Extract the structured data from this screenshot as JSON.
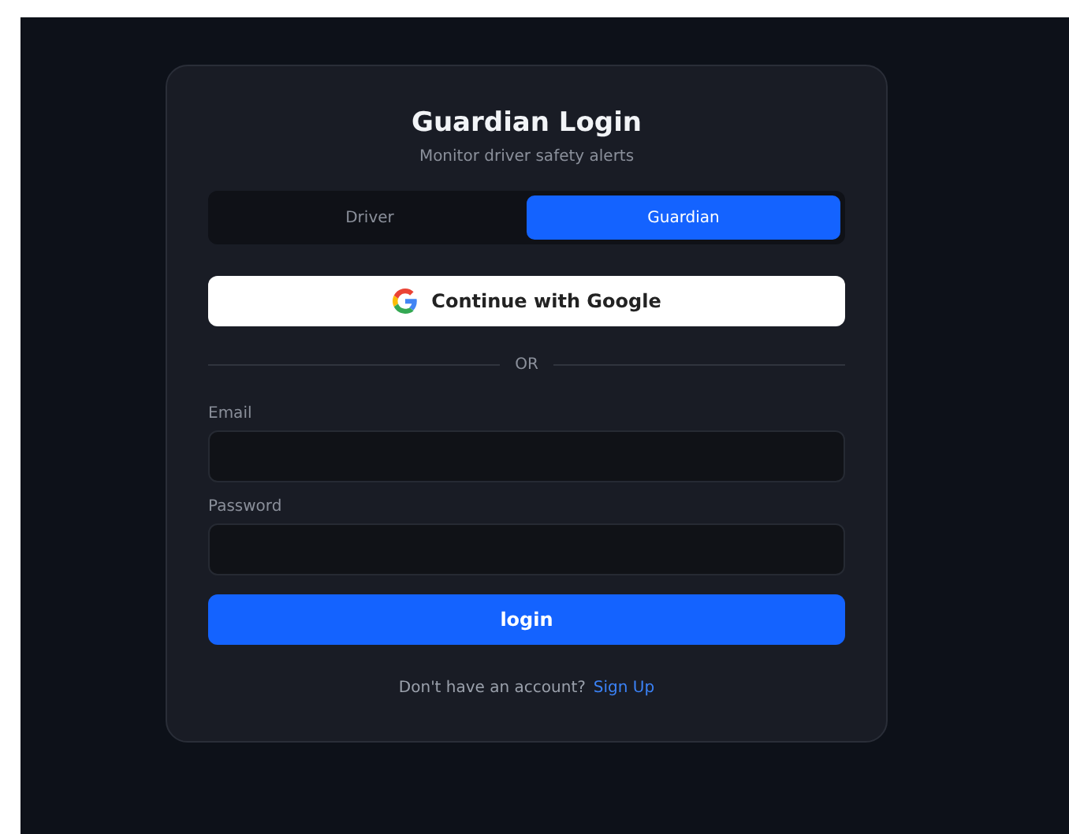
{
  "title": "Guardian Login",
  "subtitle": "Monitor driver safety alerts",
  "tabs": [
    {
      "label": "Driver",
      "selected": false
    },
    {
      "label": "Guardian",
      "selected": true
    }
  ],
  "google_button": "Continue with Google",
  "divider": "OR",
  "fields": [
    {
      "label": "Email"
    },
    {
      "label": "Password"
    }
  ],
  "submit": "login",
  "footer": {
    "text": "Don't have an account?",
    "link": "Sign Up"
  }
}
